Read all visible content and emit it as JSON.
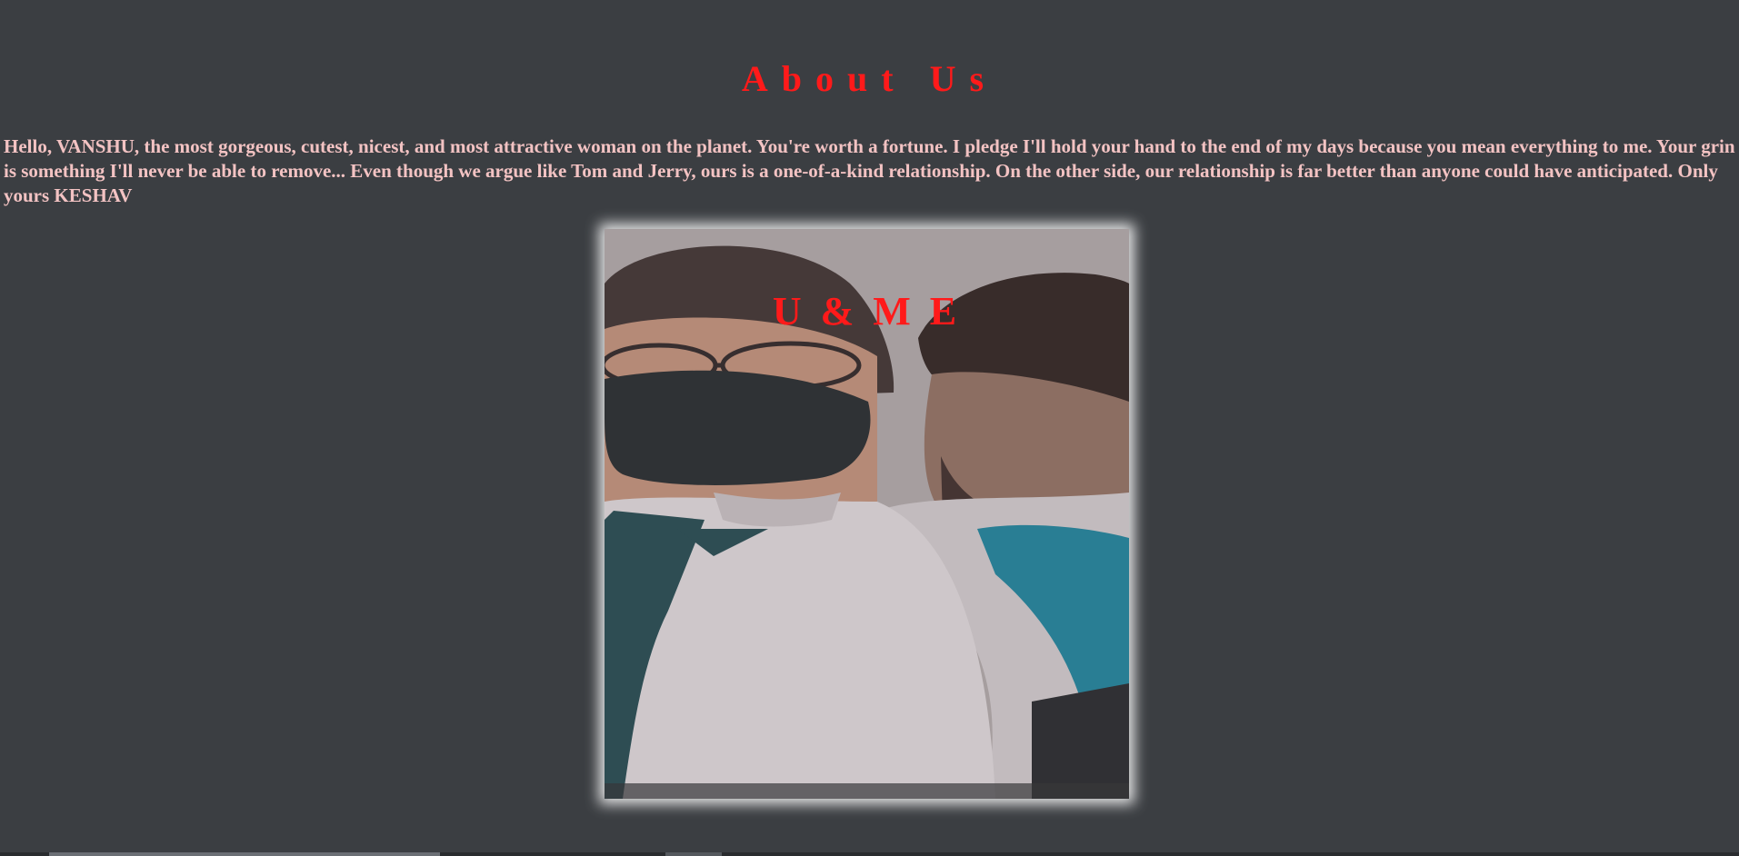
{
  "header": {
    "title": "About Us"
  },
  "about": {
    "message": "Hello, VANSHU, the most gorgeous, cutest, nicest, and most attractive woman on the planet. You're worth a fortune. I pledge I'll hold your hand to the end of my days because you mean everything to me. Your grin is something I'll never be able to remove... Even though we argue like Tom and Jerry, ours is a one-of-a-kind relationship. On the other side, our relationship is far better than anyone could have anticipated. Only yours KESHAV"
  },
  "photo": {
    "caption": "U & M E"
  },
  "colors": {
    "background": "#3b3e42",
    "title": "#ff1a1a",
    "text": "#f3c3c3"
  }
}
